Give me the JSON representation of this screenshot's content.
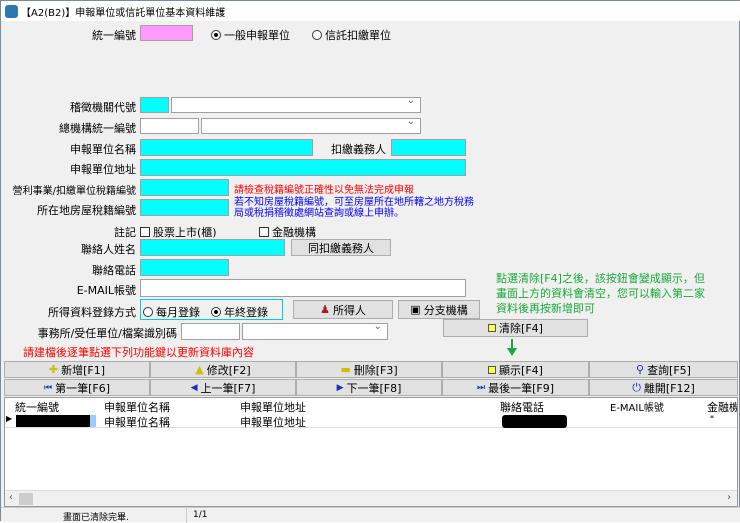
{
  "window": {
    "title": "【A2(B2)】申報單位或信託單位基本資料維護"
  },
  "form": {
    "tax_id_label": "統一編號",
    "unit_type_options": [
      "一般申報單位",
      "信託扣繳單位"
    ],
    "unit_type_selected": "一般申報單位",
    "office_code_label": "稽徵機關代號",
    "hq_tax_id_label": "總機構統一編號",
    "unit_name_label": "申報單位名稱",
    "withholder_label": "扣繳義務人",
    "unit_address_label": "申報單位地址",
    "business_tax_no_label": "營利事業/扣繳單位稅籍編號",
    "business_tax_warning": "請檢查稅籍編號正確性以免無法完成申報",
    "house_tax_no_label": "所在地房屋稅籍編號",
    "house_tax_hint": "若不知房屋稅籍編號，可至房屋所在地所轄之地方稅務局或稅捐稽徵處網站查詢或線上申辦。",
    "note_label": "註記",
    "checkbox_listed": "股票上市(櫃)",
    "checkbox_financial": "金融機構",
    "contact_name_label": "聯絡人姓名",
    "same_as_withholder_button": "同扣繳義務人",
    "contact_phone_label": "聯絡電話",
    "email_label": "E-MAIL帳號",
    "register_mode_label": "所得資料登錄方式",
    "register_mode_options": [
      "每月登錄",
      "年終登錄"
    ],
    "register_mode_selected": "年終登錄",
    "income_person_button": "所得人",
    "branch_button": "分支機構",
    "office_id_label": "事務所/受任單位/檔案識別碼",
    "clear_button": "清除[F4]",
    "update_hint": "請建檔後逐筆點選下列功能鍵以更新資料庫內容",
    "annotation": "點選清除[F4]之後，該按鈕會變成顯示，但畫面上方的資料會清空，您可以輸入第二家資料後再按新增即可"
  },
  "toolbar": {
    "row1": [
      "新增[F1]",
      "修改[F2]",
      "刪除[F3]",
      "顯示[F4]",
      "查詢[F5]"
    ],
    "row2": [
      "第一筆[F6]",
      "上一筆[F7]",
      "下一筆[F8]",
      "最後一筆[F9]",
      "離開[F12]"
    ]
  },
  "grid": {
    "headers": [
      "統一編號",
      "申報單位名稱",
      "申報單位地址",
      "聯絡電話",
      "E-MAIL帳號",
      "金融機"
    ],
    "rows": [
      {
        "unit_name": "申報單位名稱",
        "unit_address": "申報單位地址",
        "email": "",
        "financial": "*"
      }
    ]
  },
  "status": {
    "message": "畫面已清除完畢.",
    "page": "1/1"
  },
  "colors": {
    "required": "#00ffff",
    "key": "#ff99ff",
    "warning": "#ff0000",
    "hint": "#0000ff",
    "annotation": "#1aa83a"
  }
}
